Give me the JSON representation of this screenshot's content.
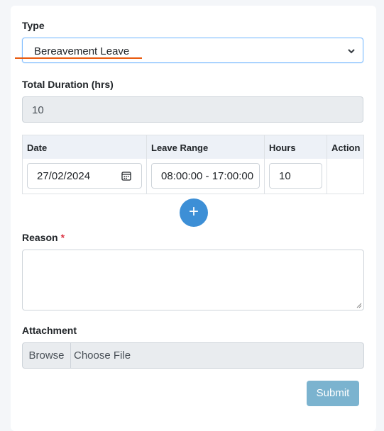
{
  "form": {
    "type_label": "Type",
    "type_value": "Bereavement Leave",
    "total_duration_label": "Total Duration (hrs)",
    "total_duration_value": "10",
    "table": {
      "headers": [
        "Date",
        "Leave Range",
        "Hours",
        "Action"
      ],
      "rows": [
        {
          "date": "27/02/2024",
          "leave_range": "08:00:00 - 17:00:00",
          "hours": "10"
        }
      ]
    },
    "add_row_label": "+",
    "reason_label": "Reason",
    "reason_required": "*",
    "reason_value": "",
    "attachment_label": "Attachment",
    "browse_label": "Browse",
    "choose_file_label": "Choose File",
    "submit_label": "Submit"
  },
  "colors": {
    "accent": "#3d8fd6",
    "submit": "#7bb3cf",
    "required": "#dc3545",
    "annotation": "#e8590c"
  },
  "icons": [
    "chevron-down-icon",
    "calendar-icon",
    "plus-icon",
    "resize-grip-icon"
  ]
}
